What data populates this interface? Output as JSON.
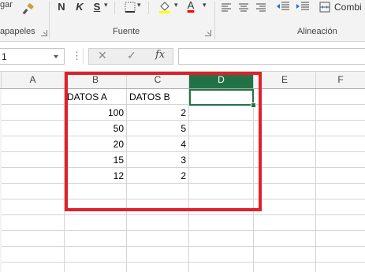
{
  "ribbon": {
    "paste_label": "gar",
    "format_painter": "brush-icon",
    "bold": "N",
    "italic": "K",
    "underline": "S",
    "underline_arrow": "▾",
    "borders_arrow": "▾",
    "fill_arrow": "▾",
    "font_color_letter": "A",
    "font_color_arrow": "▾",
    "merge_label": "Combi",
    "groups": {
      "clipboard": "apapeles",
      "font": "Fuente",
      "alignment": "Alineación"
    }
  },
  "formula_bar": {
    "name_box_value": "1",
    "cancel_symbol": "✕",
    "enter_symbol": "✓",
    "fx_symbol": "fx",
    "formula_value": ""
  },
  "columns": [
    "A",
    "B",
    "C",
    "D",
    "E",
    "F"
  ],
  "selected_column": "D",
  "cells": {
    "B1": "DATOS A",
    "C1": "DATOS B",
    "B2": "100",
    "C2": "2",
    "B3": "50",
    "C3": "5",
    "B4": "20",
    "C4": "4",
    "B5": "15",
    "C5": "3",
    "B6": "12",
    "C6": "2"
  },
  "colors": {
    "accent_green": "#217346",
    "highlight_red": "#e2202a",
    "fill_yellow": "#ffff00",
    "font_red": "#ff0000"
  }
}
